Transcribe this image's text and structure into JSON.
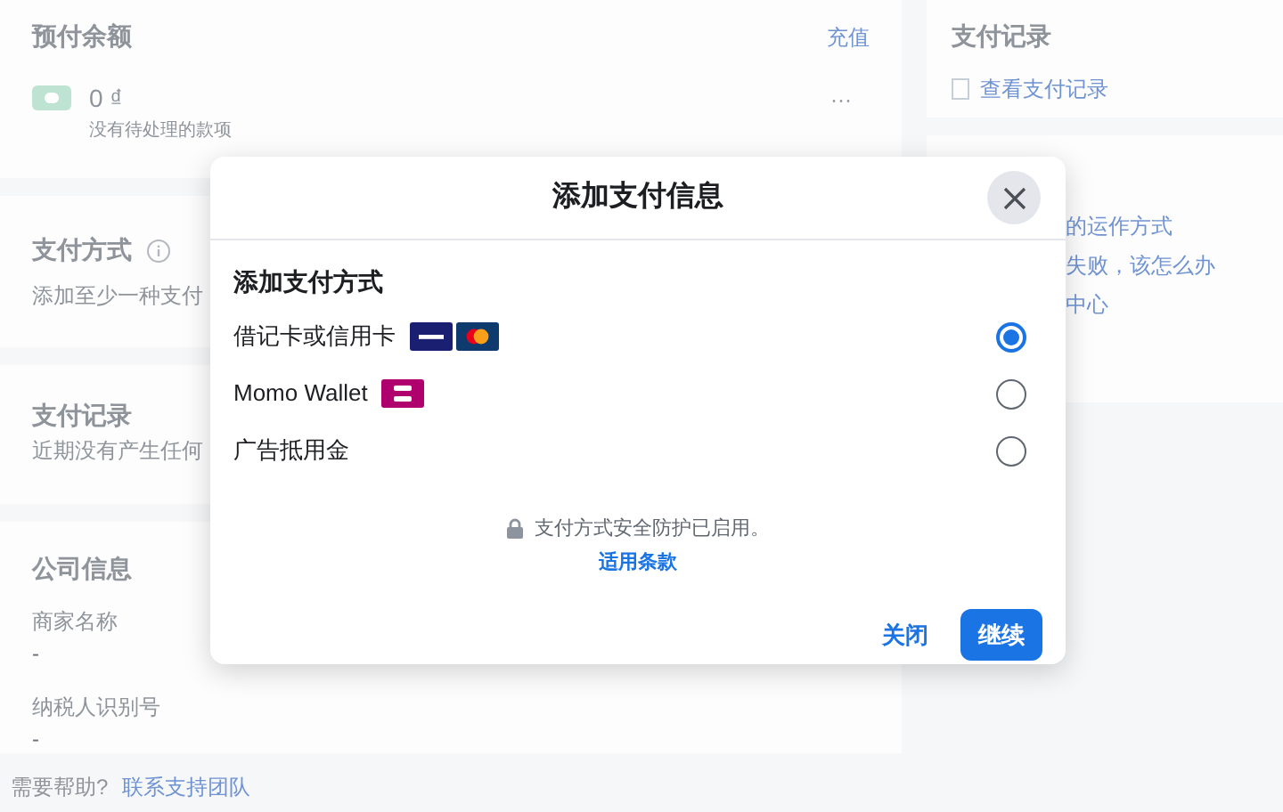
{
  "page": {
    "balance_card": {
      "title": "预付余额",
      "action": "充值",
      "amount": "0 ₫",
      "note": "没有待处理的款项",
      "more": "···"
    },
    "payment_methods_card": {
      "title": "支付方式",
      "description": "添加至少一种支付"
    },
    "history_card": {
      "title": "支付记录",
      "description": "近期没有产生任何"
    },
    "company_card": {
      "title": "公司信息",
      "fields": [
        {
          "label": "商家名称",
          "value": "-"
        },
        {
          "label": "纳税人识别号",
          "value": "-"
        }
      ]
    },
    "help": {
      "text": "需要帮助?",
      "link": "联系支持团队"
    },
    "side_history": {
      "title": "支付记录",
      "link": "查看支付记录"
    },
    "side_help": {
      "lines": [
        "的运作方式",
        "失败，该怎么办",
        "中心"
      ]
    }
  },
  "dialog": {
    "title": "添加支付信息",
    "section_title": "添加支付方式",
    "options": [
      {
        "label": "借记卡或信用卡",
        "kind": "cards",
        "selected": true
      },
      {
        "label": "Momo Wallet",
        "kind": "momo",
        "selected": false
      },
      {
        "label": "广告抵用金",
        "kind": "plain",
        "selected": false
      }
    ],
    "security_note": "支付方式安全防护已启用。",
    "terms_link": "适用条款",
    "buttons": [
      {
        "label": "关闭",
        "kind": "text"
      },
      {
        "label": "继续",
        "kind": "primary"
      }
    ]
  }
}
